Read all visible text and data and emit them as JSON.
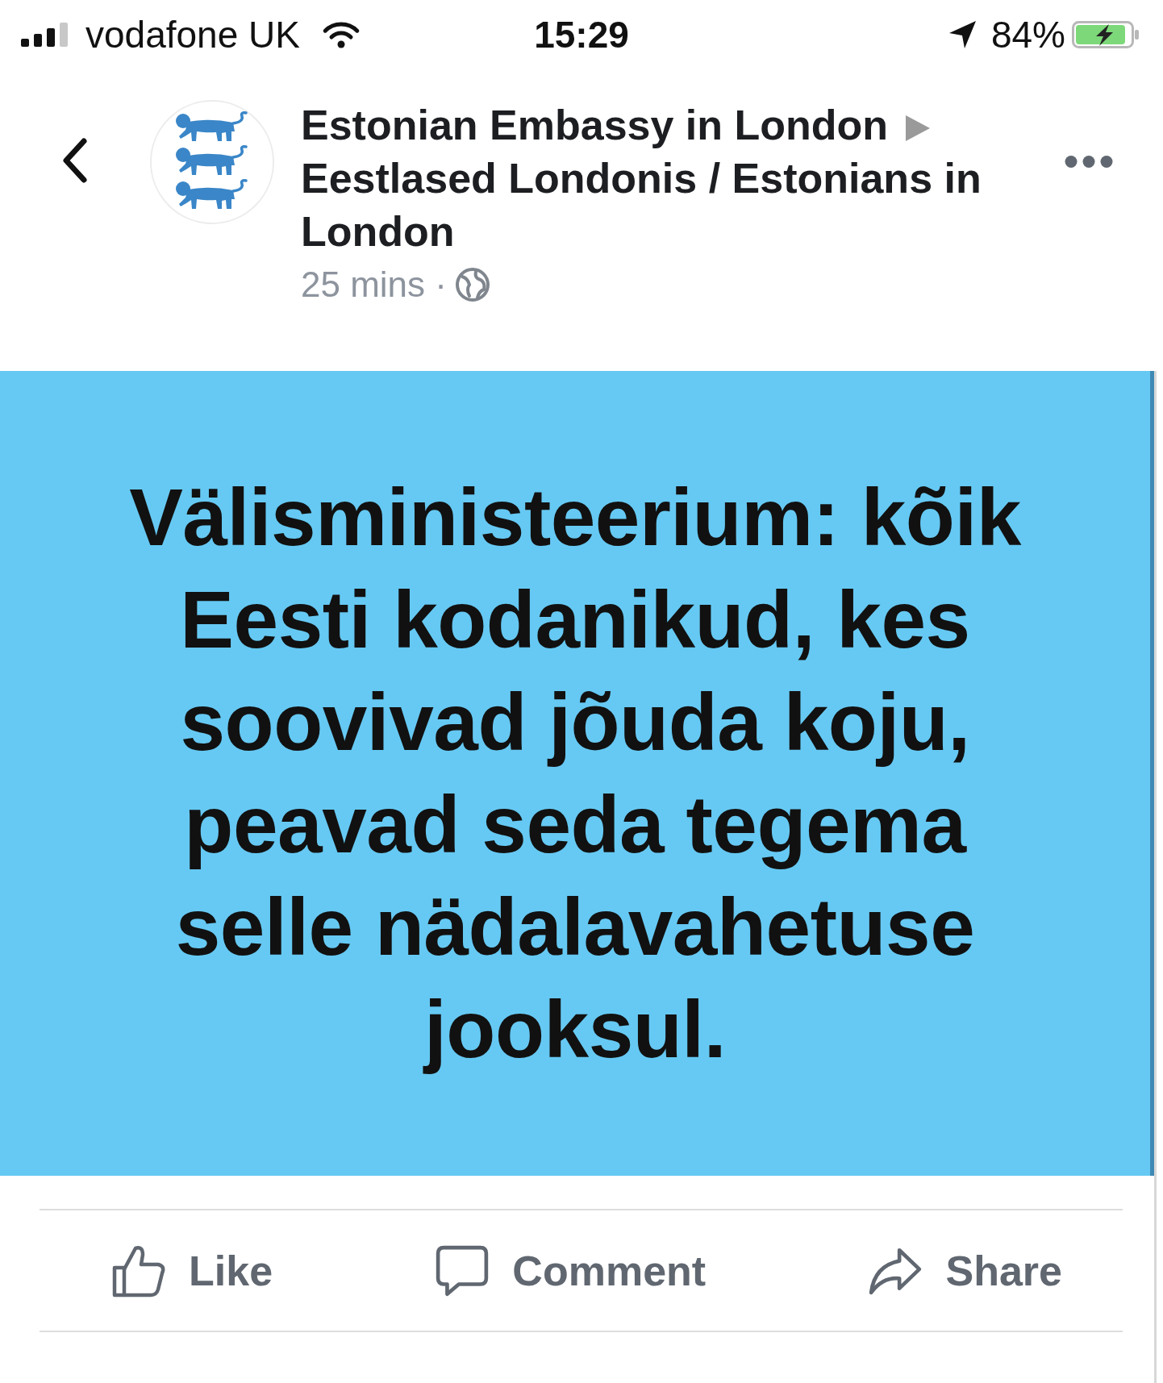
{
  "status_bar": {
    "carrier": "vodafone UK",
    "time": "15:29",
    "battery": "84%",
    "charging": true
  },
  "post": {
    "author": "Estonian Embassy in London",
    "target": "Eestlased Londonis / Estonians in London",
    "time": "25 mins ·",
    "text": "Välisministeerium: kõik Eesti kodanikud, kes soovivad jõuda koju, peavad seda tegema selle nädalavahetuse jooksul."
  },
  "actions": [
    {
      "kind": "like",
      "label": "Like"
    },
    {
      "kind": "comment",
      "label": "Comment"
    },
    {
      "kind": "share",
      "label": "Share"
    }
  ]
}
